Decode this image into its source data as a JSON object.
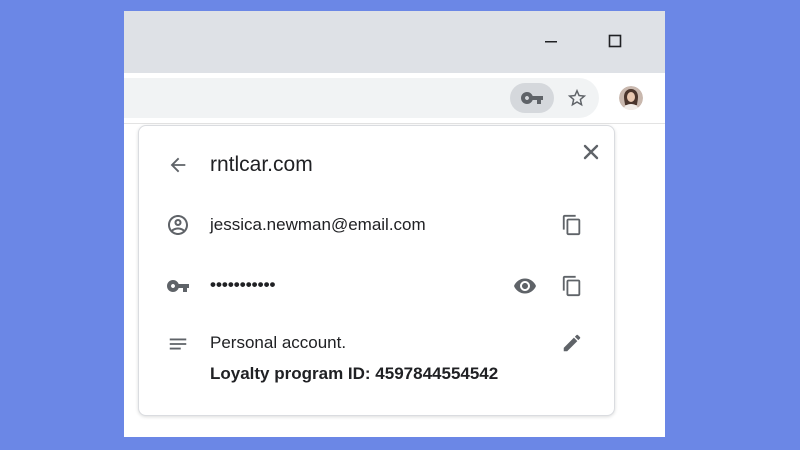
{
  "popup": {
    "site": "rntlcar.com",
    "username": "jessica.newman@email.com",
    "password_masked": "•••••••••••",
    "note_line1": "Personal account.",
    "note_line2": "Loyalty program ID: 4597844554542"
  },
  "icons": {
    "minimize": "minimize-icon",
    "maximize": "maximize-icon",
    "key": "key-icon",
    "star": "star-icon",
    "avatar": "avatar",
    "close": "close-icon",
    "back": "arrow-back-icon",
    "account": "account-circle-icon",
    "copy": "copy-icon",
    "eye": "eye-icon",
    "notes": "notes-icon",
    "edit": "pencil-icon"
  },
  "colors": {
    "background": "#6b87e6",
    "titlebar": "#dee1e6",
    "icon": "#5f6368",
    "text": "#202124"
  }
}
